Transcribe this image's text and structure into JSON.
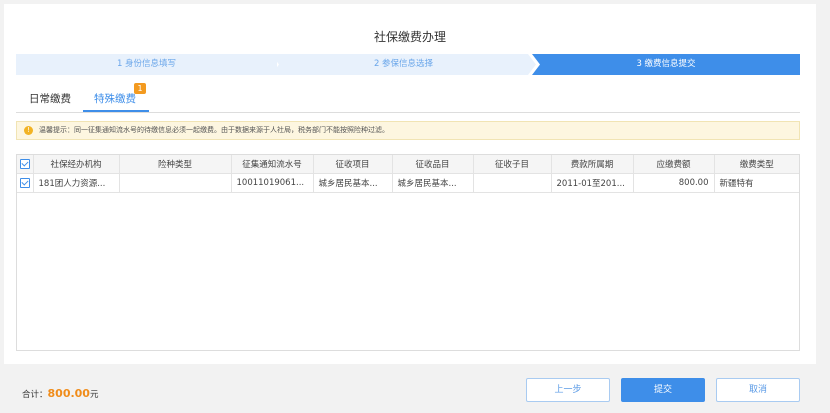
{
  "page": {
    "title": "社保缴费办理"
  },
  "steps": [
    {
      "label": "1 身份信息填写"
    },
    {
      "label": "2 参保信息选择"
    },
    {
      "label": "3 缴费信息提交"
    }
  ],
  "tabs": {
    "daily": "日常缴费",
    "special": "特殊缴费",
    "special_badge": "1"
  },
  "notice": {
    "icon": "info-icon",
    "text": "温馨提示：同一征集通知流水号的待缴信息必须一起缴费。由于数据来源于人社局，税务部门不能按照险种过滤。"
  },
  "table": {
    "headers": [
      "社保经办机构",
      "险种类型",
      "征集通知流水号",
      "征收项目",
      "征收品目",
      "征收子目",
      "费款所属期",
      "应缴费额",
      "缴费类型"
    ],
    "rows": [
      [
        "181团人力资源...",
        "",
        "10011019061...",
        "城乡居民基本...",
        "城乡居民基本...",
        "",
        "2011-01至201...",
        "800.00",
        "新疆特有"
      ]
    ]
  },
  "footer": {
    "total_label": "合计：",
    "total_amount": "800.00",
    "total_unit": "元",
    "prev_label": "上一步",
    "submit_label": "提交",
    "cancel_label": "取消"
  },
  "colors": {
    "accent": "#3e8ee9",
    "amount": "#f08c1a",
    "badge": "#f39a1f"
  }
}
